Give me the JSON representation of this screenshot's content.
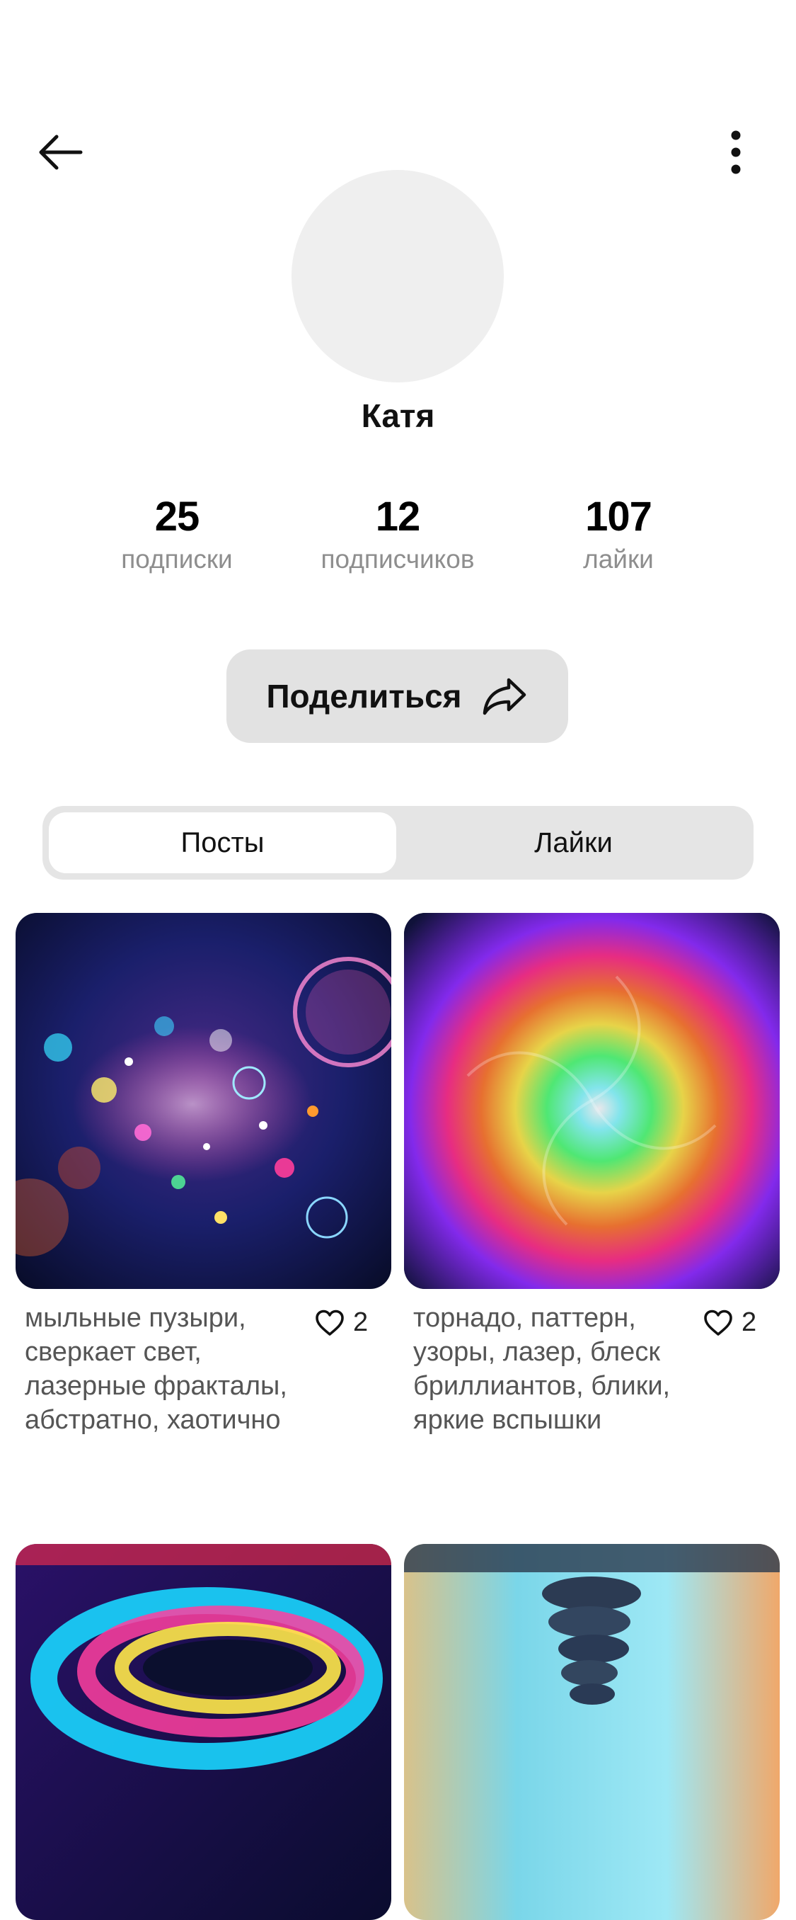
{
  "profile": {
    "name": "Катя"
  },
  "stats": [
    {
      "value": "25",
      "label": "подписки"
    },
    {
      "value": "12",
      "label": "подписчиков"
    },
    {
      "value": "107",
      "label": "лайки"
    }
  ],
  "share": {
    "label": "Поделиться"
  },
  "tabs": [
    {
      "label": "Посты",
      "selected": true
    },
    {
      "label": "Лайки",
      "selected": false
    }
  ],
  "posts": [
    {
      "caption": "мыльные пузыри, сверкает свет, лазерные фракталы, абстратно, хаотично",
      "likes": "2"
    },
    {
      "caption": "торнадо, паттерн, узоры, лазер, блеск бриллиантов, блики, яркие вспышки",
      "likes": "2"
    },
    {
      "caption": "",
      "likes": ""
    },
    {
      "caption": "",
      "likes": ""
    }
  ],
  "icons": {
    "back": "arrow-left-icon",
    "more": "more-vertical-icon",
    "share": "share-arrow-icon",
    "like": "heart-outline-icon"
  }
}
